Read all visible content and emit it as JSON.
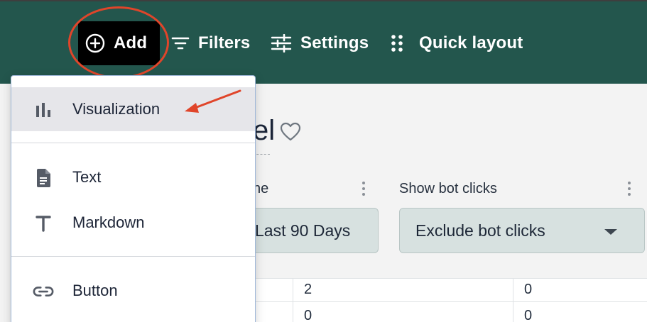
{
  "toolbar": {
    "add_label": "Add",
    "filters_label": "Filters",
    "settings_label": "Settings",
    "quick_layout_label": "Quick layout"
  },
  "page": {
    "title_fragment": "el",
    "filter_1_label_fragment": "ne",
    "filter_1_value_fragment": "Last 90 Days",
    "filter_2_label": "Show bot clicks",
    "filter_2_value": "Exclude bot clicks"
  },
  "add_menu": {
    "items": [
      {
        "label": "Visualization",
        "icon": "bar-chart-icon"
      },
      {
        "label": "Text",
        "icon": "document-icon"
      },
      {
        "label": "Markdown",
        "icon": "letter-t-icon"
      },
      {
        "label": "Button",
        "icon": "link-icon"
      }
    ]
  },
  "table": {
    "rows": [
      [
        "2",
        "0"
      ],
      [
        "0",
        "0"
      ]
    ]
  },
  "colors": {
    "topbar": "#23564d",
    "add_button": "#000000",
    "highlight": "#e0452a",
    "select_bg": "#d7e1e0",
    "menu_active_bg": "#e6e6ea"
  }
}
